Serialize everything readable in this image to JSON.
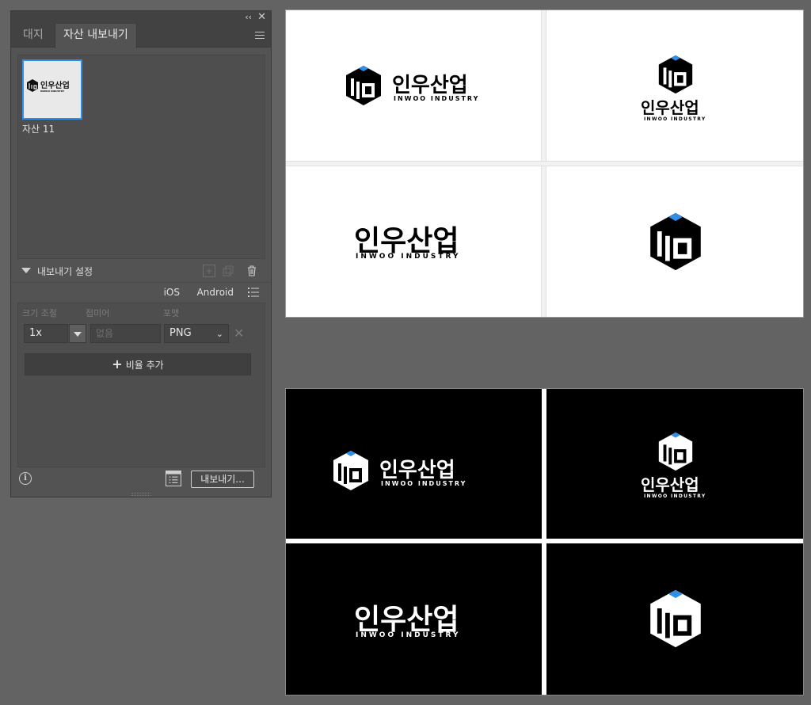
{
  "panel": {
    "collapse_label": "‹‹",
    "close_label": "✕",
    "tabs": [
      {
        "label": "대지"
      },
      {
        "label": "자산 내보내기"
      }
    ],
    "asset": {
      "name": "자산 11"
    },
    "settings_title": "내보내기 설정",
    "presets": {
      "ios": "iOS",
      "android": "Android"
    },
    "columns": {
      "scale": "크기 조절",
      "suffix": "접미어",
      "format": "포맷"
    },
    "row": {
      "scale": "1x",
      "suffix_placeholder": "없음",
      "format": "PNG"
    },
    "add_scale_label": "비율 추가",
    "export_button": "내보내기..."
  },
  "logo": {
    "korean": "인우산업",
    "english": "INWOO INDUSTRY",
    "accent_color": "#2f8fe8"
  }
}
